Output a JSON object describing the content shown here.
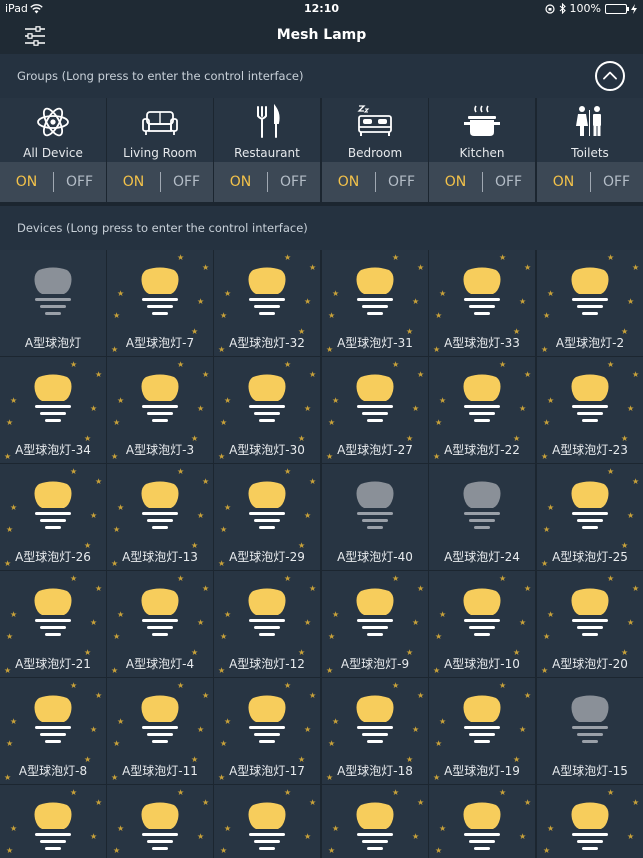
{
  "status_bar": {
    "carrier": "iPad",
    "time": "12:10",
    "battery": "100%"
  },
  "navbar": {
    "title": "Mesh Lamp"
  },
  "groups_section": {
    "header": "Groups (Long press to enter the control interface)"
  },
  "groups": [
    {
      "label": "All Device",
      "icon": "atom-icon",
      "on": "ON",
      "off": "OFF"
    },
    {
      "label": "Living Room",
      "icon": "sofa-icon",
      "on": "ON",
      "off": "OFF"
    },
    {
      "label": "Restaurant",
      "icon": "fork-knife-icon",
      "on": "ON",
      "off": "OFF"
    },
    {
      "label": "Bedroom",
      "icon": "bed-icon",
      "on": "ON",
      "off": "OFF"
    },
    {
      "label": "Kitchen",
      "icon": "pot-icon",
      "on": "ON",
      "off": "OFF"
    },
    {
      "label": "Toilets",
      "icon": "restroom-icon",
      "on": "ON",
      "off": "OFF"
    }
  ],
  "devices_section": {
    "header": "Devices (Long press to enter the control interface)"
  },
  "devices": [
    {
      "name": "A型球泡灯",
      "on": false
    },
    {
      "name": "A型球泡灯-7",
      "on": true
    },
    {
      "name": "A型球泡灯-32",
      "on": true
    },
    {
      "name": "A型球泡灯-31",
      "on": true
    },
    {
      "name": "A型球泡灯-33",
      "on": true
    },
    {
      "name": "A型球泡灯-2",
      "on": true
    },
    {
      "name": "A型球泡灯-34",
      "on": true
    },
    {
      "name": "A型球泡灯-3",
      "on": true
    },
    {
      "name": "A型球泡灯-30",
      "on": true
    },
    {
      "name": "A型球泡灯-27",
      "on": true
    },
    {
      "name": "A型球泡灯-22",
      "on": true
    },
    {
      "name": "A型球泡灯-23",
      "on": true
    },
    {
      "name": "A型球泡灯-26",
      "on": true
    },
    {
      "name": "A型球泡灯-13",
      "on": true
    },
    {
      "name": "A型球泡灯-29",
      "on": true
    },
    {
      "name": "A型球泡灯-40",
      "on": false
    },
    {
      "name": "A型球泡灯-24",
      "on": false
    },
    {
      "name": "A型球泡灯-25",
      "on": true
    },
    {
      "name": "A型球泡灯-21",
      "on": true
    },
    {
      "name": "A型球泡灯-4",
      "on": true
    },
    {
      "name": "A型球泡灯-12",
      "on": true
    },
    {
      "name": "A型球泡灯-9",
      "on": true
    },
    {
      "name": "A型球泡灯-10",
      "on": true
    },
    {
      "name": "A型球泡灯-20",
      "on": true
    },
    {
      "name": "A型球泡灯-8",
      "on": true
    },
    {
      "name": "A型球泡灯-11",
      "on": true
    },
    {
      "name": "A型球泡灯-17",
      "on": true
    },
    {
      "name": "A型球泡灯-18",
      "on": true
    },
    {
      "name": "A型球泡灯-19",
      "on": true
    },
    {
      "name": "A型球泡灯-15",
      "on": false
    },
    {
      "name": "",
      "on": true
    },
    {
      "name": "",
      "on": true
    },
    {
      "name": "",
      "on": true
    },
    {
      "name": "",
      "on": true
    },
    {
      "name": "",
      "on": true
    },
    {
      "name": "",
      "on": true
    }
  ],
  "colors": {
    "accent": "#f3c24a",
    "bulb_on": "#f7cd5c",
    "bulb_off": "#8a9098",
    "tile": "#283543",
    "background": "#1c2630"
  }
}
